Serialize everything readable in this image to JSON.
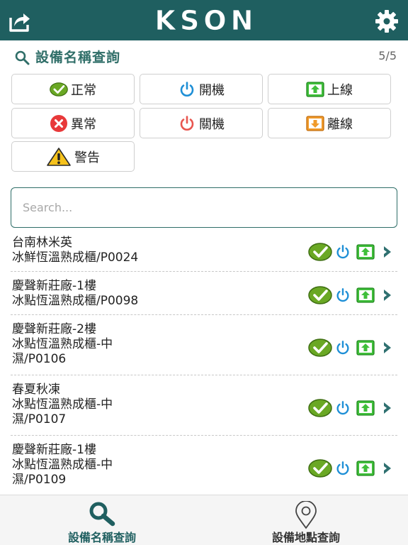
{
  "header": {
    "logo_text": "KSON",
    "share_icon": "share-export-icon",
    "settings_icon": "gear-icon"
  },
  "search_section": {
    "title": "設備名稱查詢",
    "page_count": "5/5",
    "placeholder": "Search...",
    "value": ""
  },
  "filters": [
    {
      "label": "正常",
      "icon": "check-circle-icon"
    },
    {
      "label": "開機",
      "icon": "power-on-icon"
    },
    {
      "label": "上線",
      "icon": "upload-online-icon"
    },
    {
      "label": "異常",
      "icon": "error-x-icon"
    },
    {
      "label": "關機",
      "icon": "power-off-icon"
    },
    {
      "label": "離線",
      "icon": "download-offline-icon"
    },
    {
      "label": "警告",
      "icon": "warning-triangle-icon"
    }
  ],
  "devices": [
    {
      "lines": [
        "台南林米英",
        "冰鮮恆溫熟成櫃/P0024"
      ]
    },
    {
      "lines": [
        "慶聲新莊廠-1樓",
        "冰點恆溫熟成櫃/P0098"
      ]
    },
    {
      "lines": [
        "慶聲新莊廠-2樓",
        "冰點恆溫熟成櫃-中",
        "濕/P0106"
      ]
    },
    {
      "lines": [
        "春夏秋凍",
        "冰點恆溫熟成櫃-中",
        "濕/P0107"
      ]
    },
    {
      "lines": [
        "慶聲新莊廠-1樓",
        "冰點恆溫熟成櫃-中",
        "濕/P0109"
      ]
    }
  ],
  "tabs": [
    {
      "label": "設備名稱查詢",
      "icon": "search-icon",
      "active": true
    },
    {
      "label": "設備地點查詢",
      "icon": "map-pin-icon",
      "active": false
    }
  ],
  "colors": {
    "brand": "#1f5f60",
    "ok_green": "#6aa824",
    "power_blue": "#1e8fd6",
    "online_green": "#3fbf3a",
    "error_red": "#e8393a",
    "offline_orange": "#f09a2a",
    "warning_yellow": "#f6c21b"
  }
}
